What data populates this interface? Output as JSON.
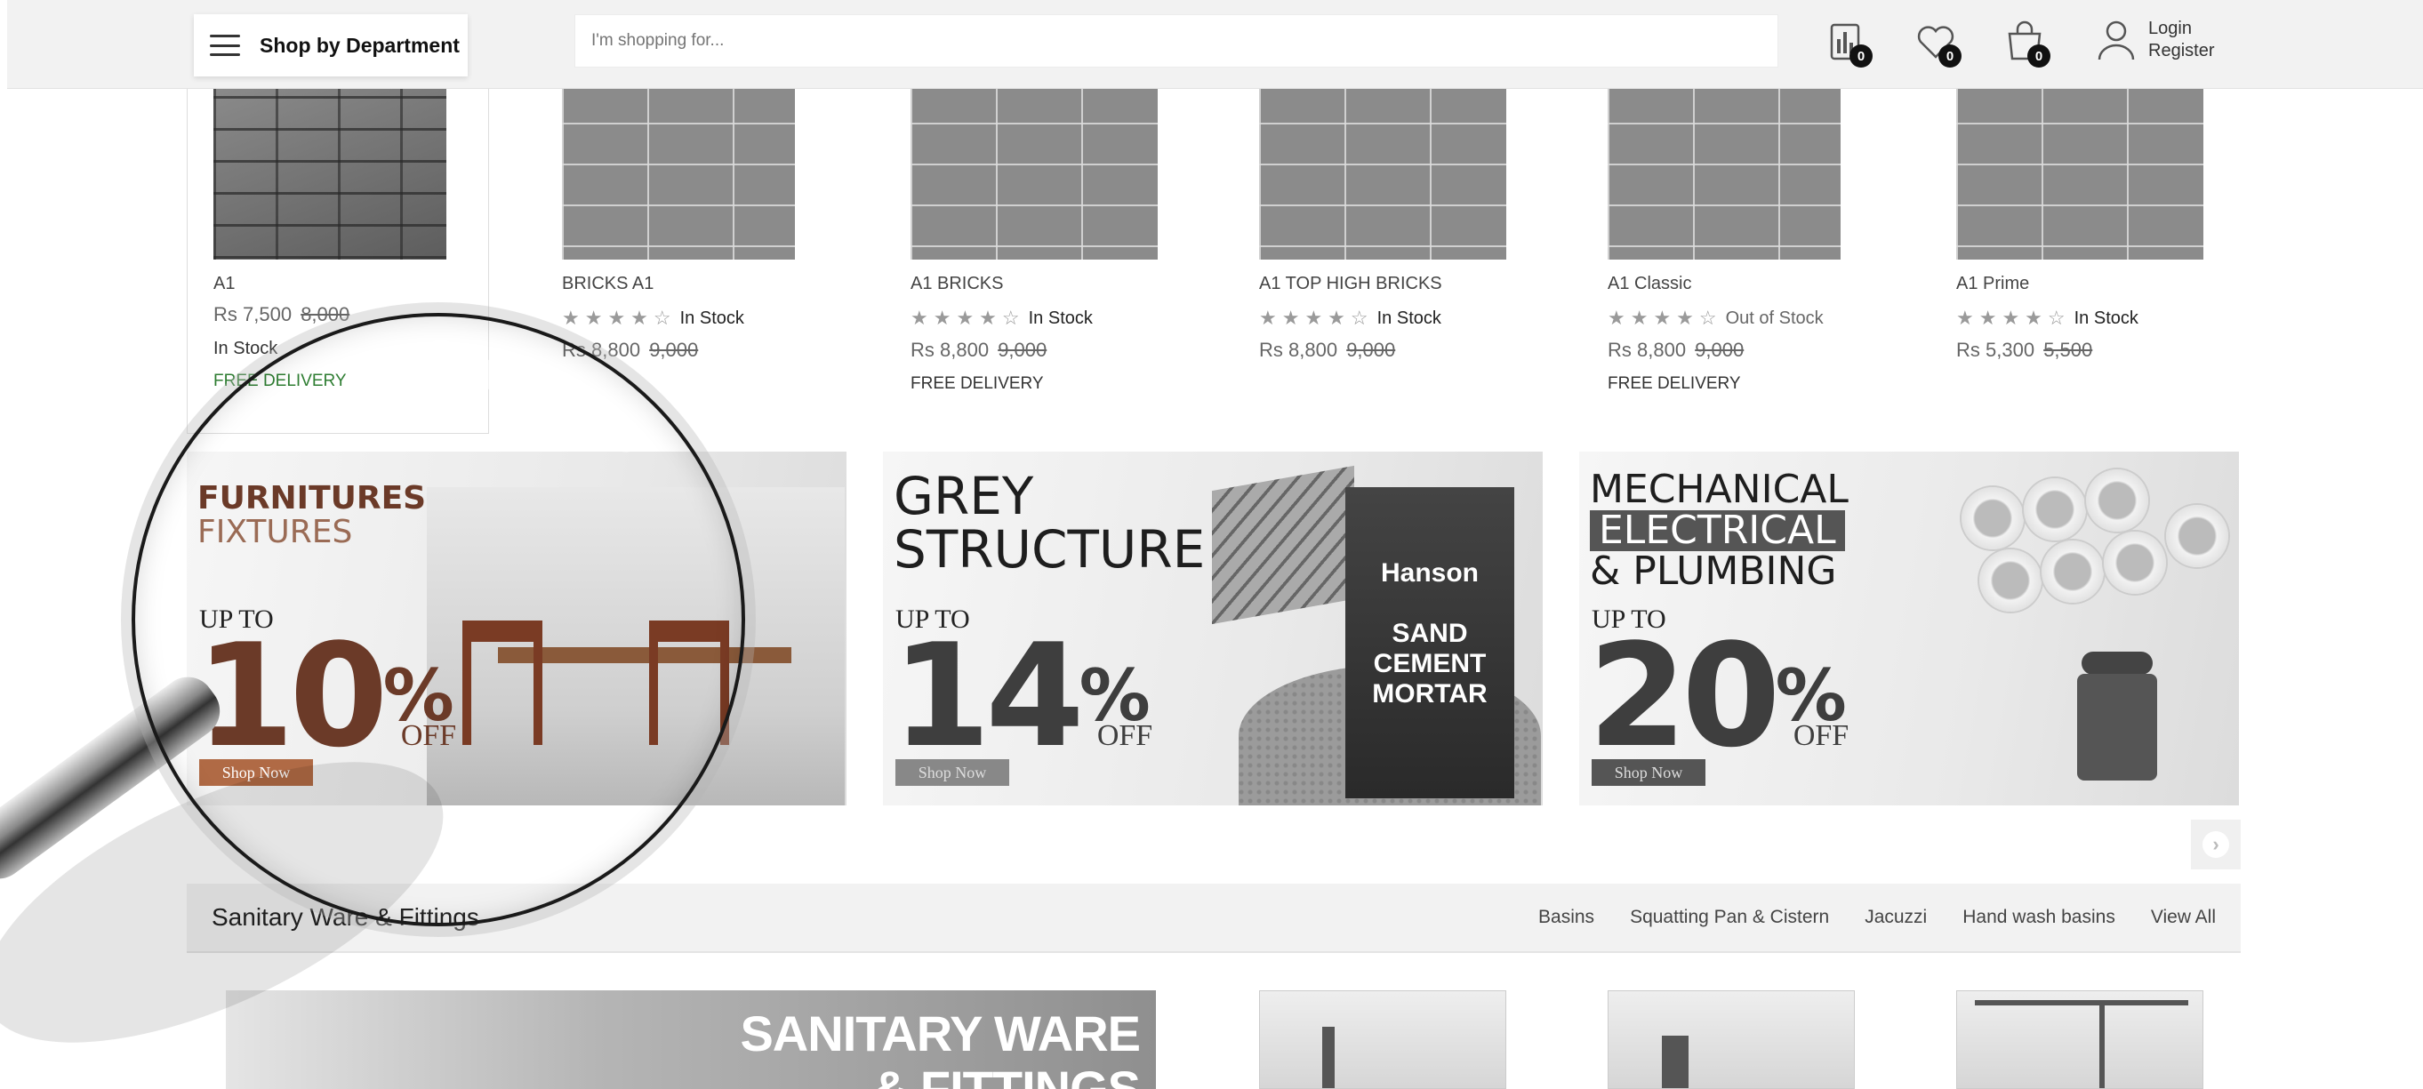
{
  "header": {
    "department_label": "Shop by Department",
    "search_placeholder": "I'm shopping for...",
    "compare_count": "0",
    "wishlist_count": "0",
    "cart_count": "0",
    "login_label": "Login",
    "register_label": "Register"
  },
  "products": [
    {
      "name": "A1",
      "price": "Rs 7,500",
      "old_price": "8,000",
      "stock": "In Stock",
      "delivery": "FREE DELIVERY"
    },
    {
      "name": "BRICKS A1",
      "rating": 4,
      "stock": "In Stock",
      "price": "Rs 8,800",
      "old_price": "9,000"
    },
    {
      "name": "A1 BRICKS",
      "rating": 4,
      "stock": "In Stock",
      "price": "Rs 8,800",
      "old_price": "9,000",
      "delivery": "FREE DELIVERY"
    },
    {
      "name": "A1 TOP HIGH BRICKS",
      "rating": 4,
      "stock": "In Stock",
      "price": "Rs 8,800",
      "old_price": "9,000"
    },
    {
      "name": "A1 Classic",
      "rating": 4,
      "stock": "Out of Stock",
      "price": "Rs 8,800",
      "old_price": "9,000",
      "delivery": "FREE DELIVERY"
    },
    {
      "name": "A1 Prime",
      "rating": 4,
      "stock": "In Stock",
      "price": "Rs 5,300",
      "old_price": "5,500"
    }
  ],
  "stars": {
    "filled": "★★★★",
    "empty": "☆"
  },
  "banners": [
    {
      "title_1": "FURNITURES",
      "title_2": "FIXTURES",
      "upto": "UP TO",
      "percent": "10",
      "off": "OFF",
      "button": "Shop Now"
    },
    {
      "title_1": "GREY",
      "title_2": "STRUCTURE",
      "upto": "UP TO",
      "percent": "14",
      "off": "OFF",
      "button": "Shop Now",
      "product_brand": "Hanson",
      "product_name": "SAND CEMENT MORTAR"
    },
    {
      "title_1": "MECHANICAL",
      "title_2": "ELECTRICAL",
      "title_3": "& PLUMBING",
      "upto": "UP TO",
      "percent": "20",
      "off": "OFF",
      "button": "Shop Now"
    }
  ],
  "carousel": {
    "next_symbol": "›"
  },
  "category": {
    "title": "Sanitary Ware & Fittings",
    "links": [
      "Basins",
      "Squatting Pan & Cistern",
      "Jacuzzi",
      "Hand wash basins",
      "View All"
    ]
  },
  "promo": {
    "line_1": "SANITARY WARE",
    "line_2": "& FITTINGS"
  },
  "colors": {
    "header_bg": "#f2f2f2",
    "accent_brown": "#6b3a28",
    "button_brown": "#b06a45",
    "free_delivery_green": "#2e7d32"
  }
}
